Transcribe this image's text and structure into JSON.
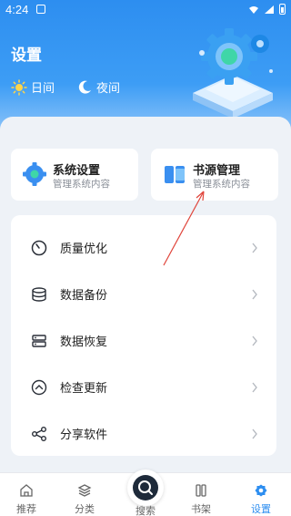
{
  "status": {
    "time": "4:24"
  },
  "header": {
    "title": "设置"
  },
  "modes": [
    {
      "label": "日间"
    },
    {
      "label": "夜间"
    }
  ],
  "cards": [
    {
      "title": "系统设置",
      "subtitle": "管理系统内容"
    },
    {
      "title": "书源管理",
      "subtitle": "管理系统内容"
    }
  ],
  "list": [
    {
      "label": "质量优化"
    },
    {
      "label": "数据备份"
    },
    {
      "label": "数据恢复"
    },
    {
      "label": "检查更新"
    },
    {
      "label": "分享软件"
    }
  ],
  "tabs": [
    {
      "label": "推荐"
    },
    {
      "label": "分类"
    },
    {
      "label": "搜索"
    },
    {
      "label": "书架"
    },
    {
      "label": "设置"
    }
  ],
  "colors": {
    "accent": "#2d8ef0",
    "hero": "#3d9df5",
    "annotation": "#e0443a"
  }
}
